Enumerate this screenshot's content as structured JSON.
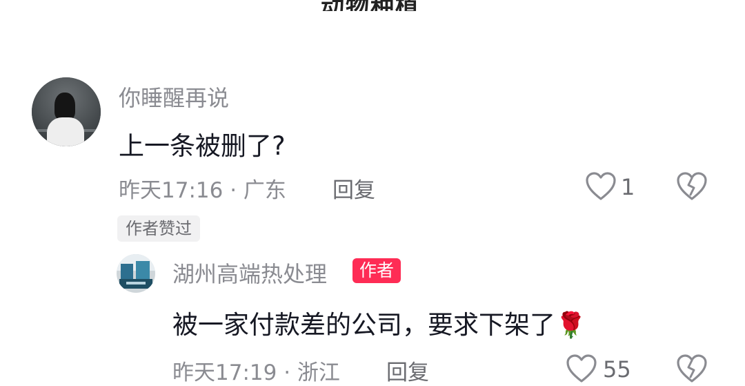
{
  "top_cut_text": "动物种植",
  "comment": {
    "username": "你睡醒再说",
    "text": "上一条被删了?",
    "time_location": "昨天17:16 · 广东",
    "reply_label": "回复",
    "likes": "1",
    "author_liked_badge": "作者赞过"
  },
  "reply": {
    "username": "湖州高端热处理",
    "author_badge": "作者",
    "text": "被一家付款差的公司，要求下架了",
    "emoji": "🌹",
    "time_location": "昨天17:19 · 浙江",
    "reply_label": "回复",
    "likes": "55"
  },
  "colors": {
    "accent_author": "#fe2c55",
    "meta_gray": "#8a8b91",
    "text_dark": "#161823"
  }
}
